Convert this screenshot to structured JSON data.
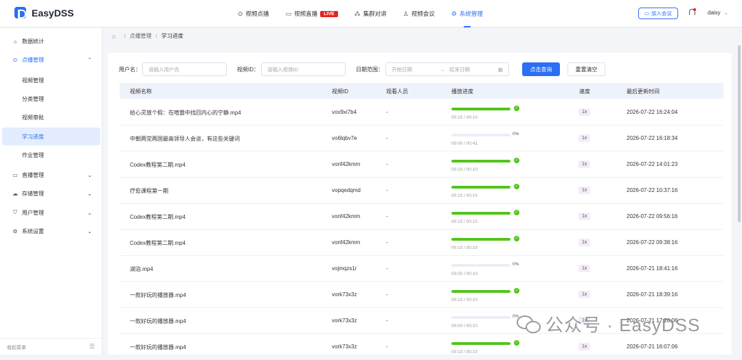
{
  "app": {
    "name": "EasyDSS"
  },
  "nav": {
    "items": [
      {
        "label": "视频点播",
        "icon": "play-circle-icon"
      },
      {
        "label": "视频直播",
        "icon": "video-camera-icon",
        "badge": "LIVE"
      },
      {
        "label": "集群对讲",
        "icon": "broadcast-icon"
      },
      {
        "label": "视频会议",
        "icon": "users-icon"
      },
      {
        "label": "系统管理",
        "icon": "gear-icon",
        "active": true
      }
    ]
  },
  "header": {
    "join_meeting": "加入会议",
    "username": "daisy"
  },
  "sidebar": {
    "items": [
      {
        "label": "数据统计",
        "icon": "home-icon"
      },
      {
        "label": "点播管理",
        "icon": "play-circle-icon",
        "open": true
      },
      {
        "label": "直播管理",
        "icon": "video-camera-icon"
      },
      {
        "label": "存储管理",
        "icon": "cloud-icon"
      },
      {
        "label": "用户管理",
        "icon": "shield-icon"
      },
      {
        "label": "系统设置",
        "icon": "gear-icon"
      }
    ],
    "sub_items": [
      "视频管理",
      "分类管理",
      "视频审批",
      "学习进度",
      "作业管理"
    ],
    "active_sub": "学习进度",
    "footer": "收起菜单"
  },
  "breadcrumb": [
    "点播管理",
    "学习进度"
  ],
  "filters": {
    "username_label": "用户名：",
    "username_placeholder": "请输入用户名",
    "videoid_label": "视频ID：",
    "videoid_placeholder": "请输入视频ID",
    "daterange_label": "日期范围：",
    "start_placeholder": "开始日期",
    "arrow": "→",
    "end_placeholder": "结束日期",
    "query_button": "点击查询",
    "reset_button": "重置清空"
  },
  "table": {
    "columns": [
      "视频名称",
      "视频ID",
      "观看人员",
      "播放进度",
      "速度",
      "最后更新时间"
    ],
    "rows": [
      {
        "name": "给心灵放个假：在喧嚣中找回内心的宁静.mp4",
        "vid": "vox9xi7b4",
        "viewer": "-",
        "progress": 1.0,
        "progress_text": "00:10 / 00:10",
        "speed": "1x",
        "time": "2026-07-22 16:24:04"
      },
      {
        "name": "中朝两党两国最高领导人会谈，有这些关键词",
        "vid": "vo6lqbv7e",
        "viewer": "-",
        "progress": 0.0,
        "pct": "0%",
        "progress_text": "00:00 / 00:41",
        "speed": "1x",
        "time": "2026-07-22 16:18:34"
      },
      {
        "name": "Codex教程第二期.mp4",
        "vid": "vonf42kmm",
        "viewer": "-",
        "progress": 1.0,
        "progress_text": "00:10 / 00:10",
        "speed": "1x",
        "time": "2026-07-22 14:01:23"
      },
      {
        "name": "疗愈课程第一期",
        "vid": "vopqedqmd",
        "viewer": "-",
        "progress": 1.0,
        "progress_text": "00:10 / 00:10",
        "speed": "1x",
        "time": "2026-07-22 10:37:16"
      },
      {
        "name": "Codex教程第二期.mp4",
        "vid": "vonf42kmm",
        "viewer": "-",
        "progress": 1.0,
        "progress_text": "00:10 / 00:10",
        "speed": "1x",
        "time": "2026-07-22 09:56:16"
      },
      {
        "name": "Codex教程第二期.mp4",
        "vid": "vonf42kmm",
        "viewer": "-",
        "progress": 1.0,
        "progress_text": "00:10 / 00:10",
        "speed": "1x",
        "time": "2026-07-22 09:38:16"
      },
      {
        "name": "湖泊.mp4",
        "vid": "vojmqzs1r",
        "viewer": "-",
        "progress": 0.0,
        "pct": "0%",
        "progress_text": "00:00 / 00:10",
        "speed": "1x",
        "time": "2026-07-21 18:41:16"
      },
      {
        "name": "一款好玩的播放器.mp4",
        "vid": "vork73x3z",
        "viewer": "-",
        "progress": 1.0,
        "progress_text": "00:10 / 00:10",
        "speed": "1x",
        "time": "2026-07-21 18:39:16"
      },
      {
        "name": "一款好玩的播放器.mp4",
        "vid": "vork73x3z",
        "viewer": "-",
        "progress": 0.0,
        "pct": "0%",
        "progress_text": "00:00 / 00:10",
        "speed": "1x",
        "time": "2026-07-21 17:26:06"
      },
      {
        "name": "一款好玩的播放器.mp4",
        "vid": "vork73x3z",
        "viewer": "-",
        "progress": 1.0,
        "progress_text": "00:10 / 00:10",
        "speed": "1x",
        "time": "2026-07-21 16:07:06"
      }
    ]
  },
  "watermark": {
    "text": "公众号 · EasyDSS"
  },
  "colors": {
    "accent": "#2b6ff5",
    "success": "#52c41a",
    "live": "#e5231e"
  }
}
